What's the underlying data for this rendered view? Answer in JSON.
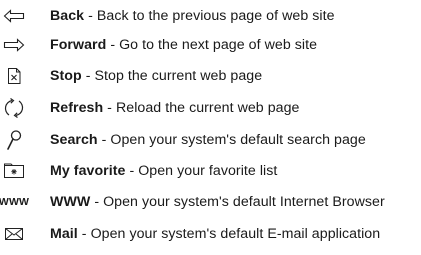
{
  "items": [
    {
      "icon": "back-arrow-icon",
      "name": "Back",
      "sep": " - ",
      "desc": "Back to the previous page of web site"
    },
    {
      "icon": "forward-arrow-icon",
      "name": "Forward",
      "sep": " - ",
      "desc": "Go to the next page of web site"
    },
    {
      "icon": "stop-icon",
      "name": "Stop",
      "sep": " - ",
      "desc": "Stop the current web page"
    },
    {
      "icon": "refresh-icon",
      "name": "Refresh",
      "sep": " - ",
      "desc": "Reload the current web page"
    },
    {
      "icon": "search-icon",
      "name": "Search",
      "sep": " - ",
      "desc": "Open your system's default search page"
    },
    {
      "icon": "favorite-folder-icon",
      "name": "My favorite",
      "sep": " - ",
      "desc": "Open your favorite list"
    },
    {
      "icon": "www-icon",
      "icon_text": "WWW",
      "name": "WWW",
      "sep": " - ",
      "desc": "Open your system's default Internet Browser"
    },
    {
      "icon": "mail-icon",
      "name": "Mail",
      "sep": " - ",
      "desc": "Open your system's default E-mail application"
    }
  ]
}
